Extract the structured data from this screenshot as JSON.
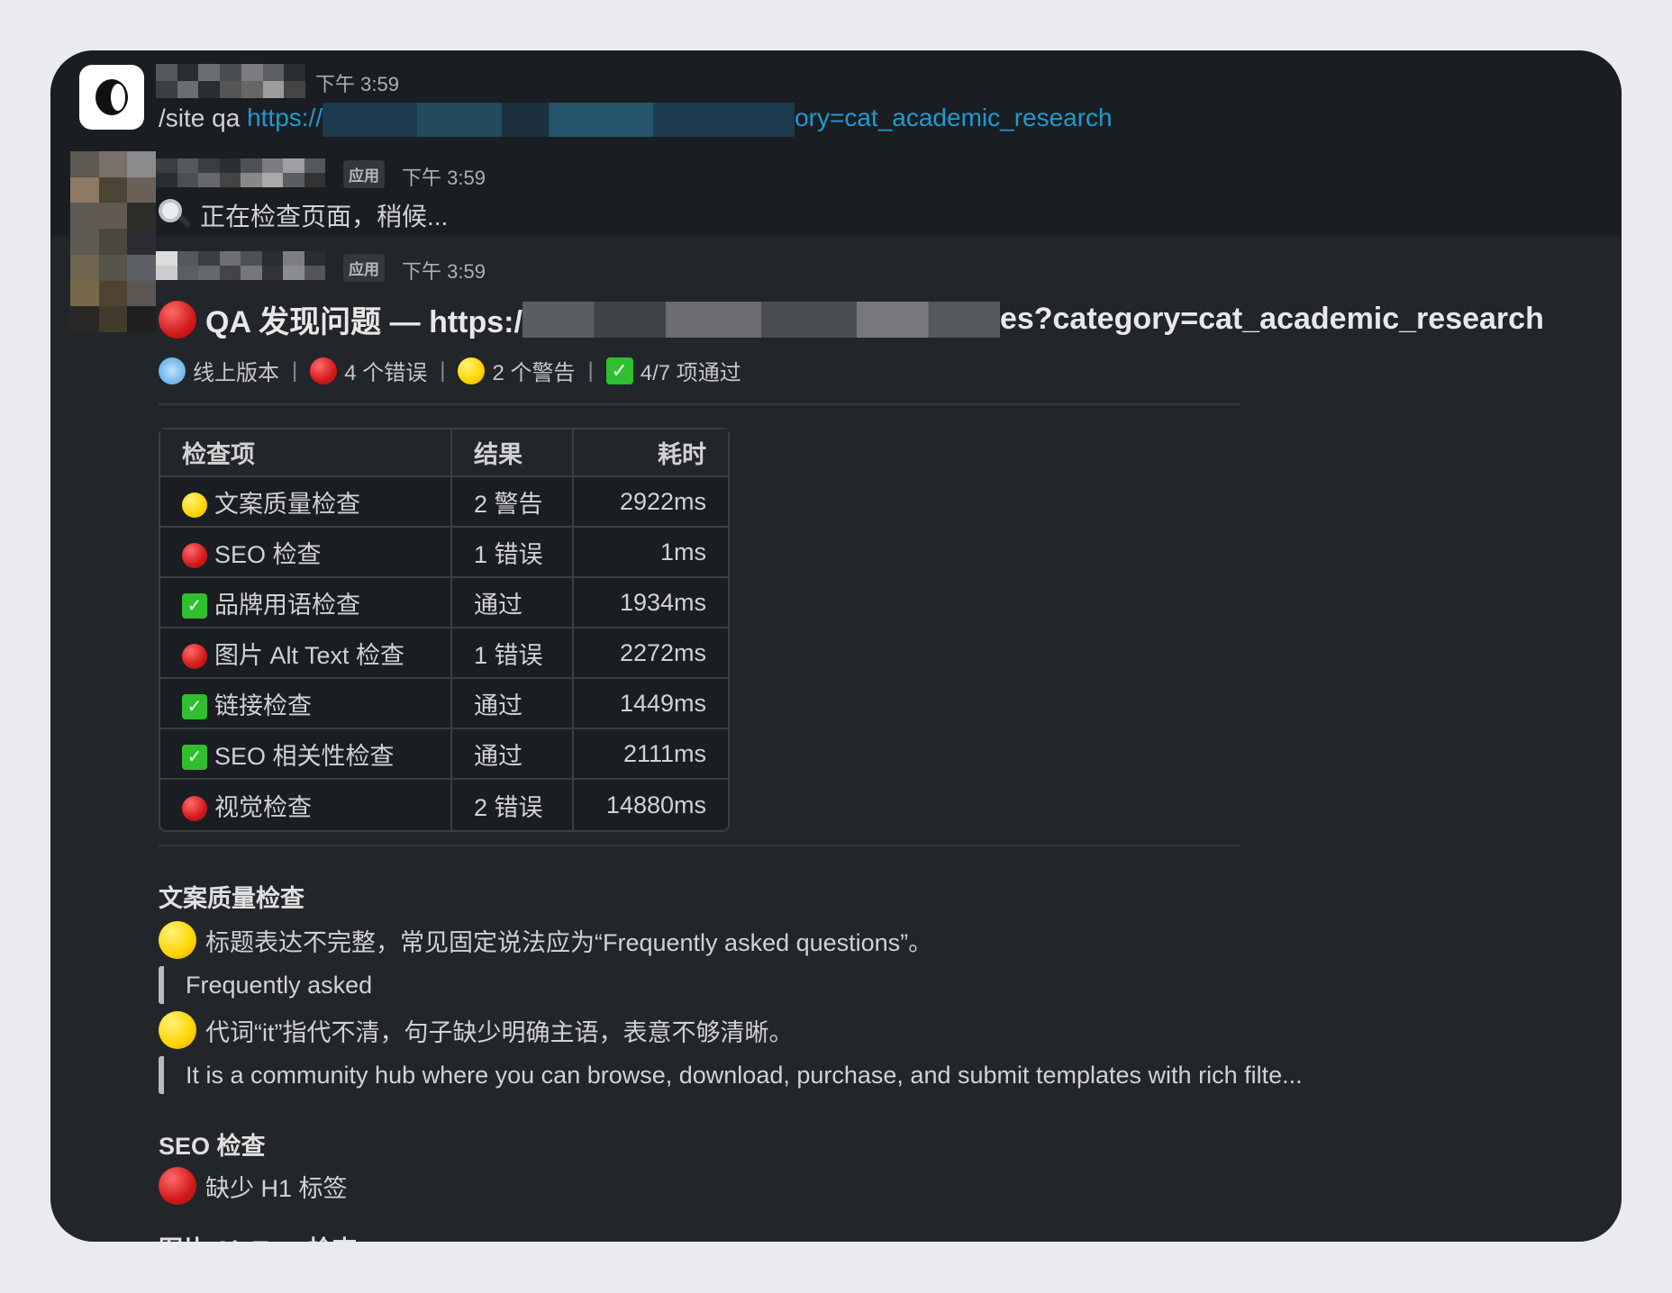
{
  "messages": [
    {
      "time": "下午 3:59",
      "command": "/site qa",
      "link_start": "https://",
      "link_end": "ory=cat_academic_research"
    },
    {
      "badge": "应用",
      "time": "下午 3:59",
      "text": "正在检查页面，稍候..."
    },
    {
      "badge": "应用",
      "time": "下午 3:59",
      "title_prefix": "QA 发现问题 — https:/",
      "title_suffix": "es?category=cat_academic_research",
      "status": {
        "env": "线上版本",
        "errors": "4 个错误",
        "warnings": "2 个警告",
        "passed": "4/7 项通过"
      },
      "table": {
        "headers": [
          "检查项",
          "结果",
          "耗时"
        ],
        "rows": [
          {
            "status": "warning",
            "item": "文案质量检查",
            "result": "2 警告",
            "time": "2922ms"
          },
          {
            "status": "error",
            "item": "SEO 检查",
            "result": "1 错误",
            "time": "1ms"
          },
          {
            "status": "pass",
            "item": "品牌用语检查",
            "result": "通过",
            "time": "1934ms"
          },
          {
            "status": "error",
            "item": "图片 Alt Text 检查",
            "result": "1 错误",
            "time": "2272ms"
          },
          {
            "status": "pass",
            "item": "链接检查",
            "result": "通过",
            "time": "1449ms"
          },
          {
            "status": "pass",
            "item": "SEO 相关性检查",
            "result": "通过",
            "time": "2111ms"
          },
          {
            "status": "error",
            "item": "视觉检查",
            "result": "2 错误",
            "time": "14880ms"
          }
        ]
      },
      "sections": [
        {
          "title": "文案质量检查",
          "issues": [
            {
              "level": "warning",
              "text": "标题表达不完整，常见固定说法应为“Frequently asked questions”。",
              "quote": "Frequently asked"
            },
            {
              "level": "warning",
              "text": "代词“it”指代不清，句子缺少明确主语，表意不够清晰。",
              "quote": "It is a community hub where you can browse, download, purchase, and submit templates with rich filte..."
            }
          ]
        },
        {
          "title": "SEO 检查",
          "issues": [
            {
              "level": "error",
              "text": "缺少 H1 标签"
            }
          ]
        },
        {
          "title": "图片 Alt Text 检查"
        }
      ]
    }
  ],
  "colors": {
    "link": "#1d9bd1",
    "bg": "#222529",
    "error": "#d11a1a",
    "warning": "#ffd500",
    "pass": "#2fbf2f"
  }
}
